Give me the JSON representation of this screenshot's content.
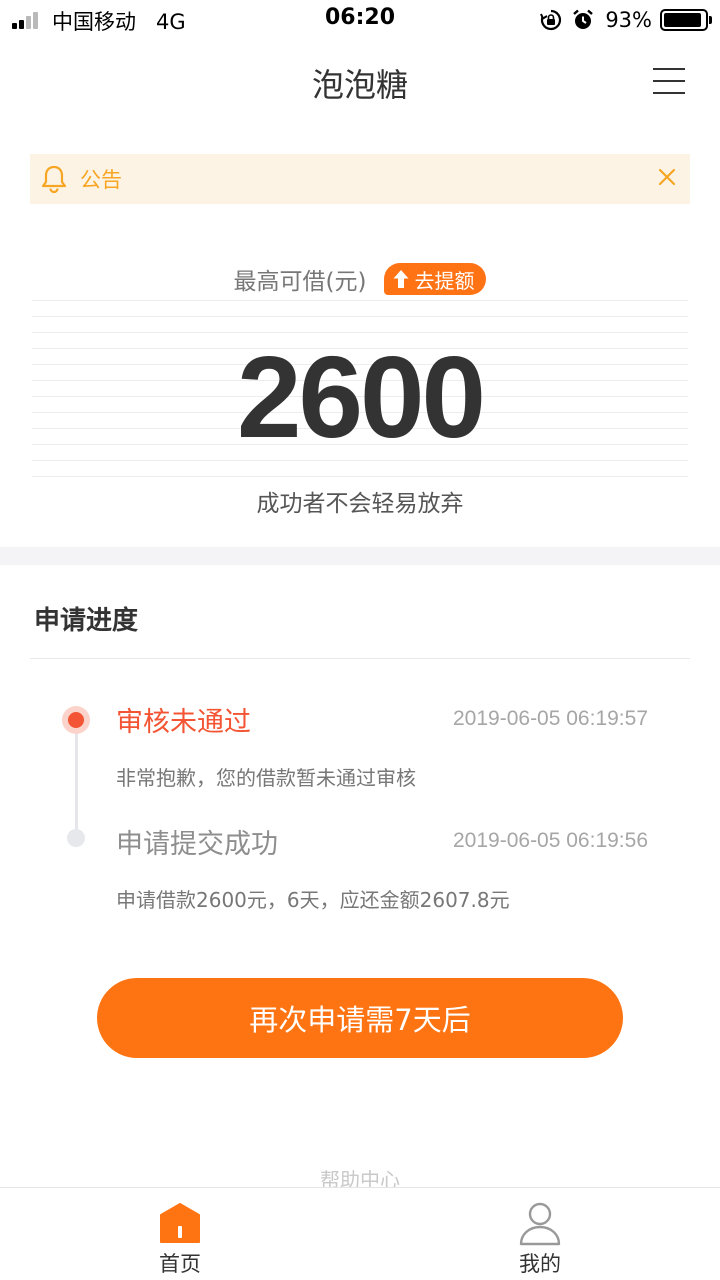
{
  "status_bar": {
    "carrier": "中国移动",
    "network": "4G",
    "time": "06:20",
    "battery_percent": "93%",
    "battery_level": 0.93
  },
  "nav": {
    "title": "泡泡糖",
    "menu_icon": "hamburger-menu-icon"
  },
  "notice": {
    "icon": "bell-icon",
    "label": "公告",
    "close_icon": "close-icon"
  },
  "amount": {
    "label": "最高可借(元)",
    "raise_button": "去提额",
    "value": "2600",
    "slogan": "成功者不会轻易放弃"
  },
  "progress": {
    "title": "申请进度",
    "steps": [
      {
        "title": "审核未通过",
        "time": "2019-06-05 06:19:57",
        "description": "非常抱歉，您的借款暂未通过审核",
        "state": "rejected"
      },
      {
        "title": "申请提交成功",
        "time": "2019-06-05 06:19:56",
        "description": "申请借款2600元，6天，应还金额2607.8元",
        "state": "done"
      }
    ]
  },
  "action": {
    "label": "再次申请需7天后"
  },
  "help": {
    "label": "帮助中心"
  },
  "tabbar": {
    "items": [
      {
        "label": "首页",
        "icon": "home-icon",
        "active": true
      },
      {
        "label": "我的",
        "icon": "user-icon",
        "active": false
      }
    ]
  },
  "colors": {
    "accent": "#ff7412",
    "notice_text": "#f6a623",
    "notice_bg": "#fdf3e5",
    "rejected": "#f35434",
    "muted": "#a6a6a6"
  }
}
